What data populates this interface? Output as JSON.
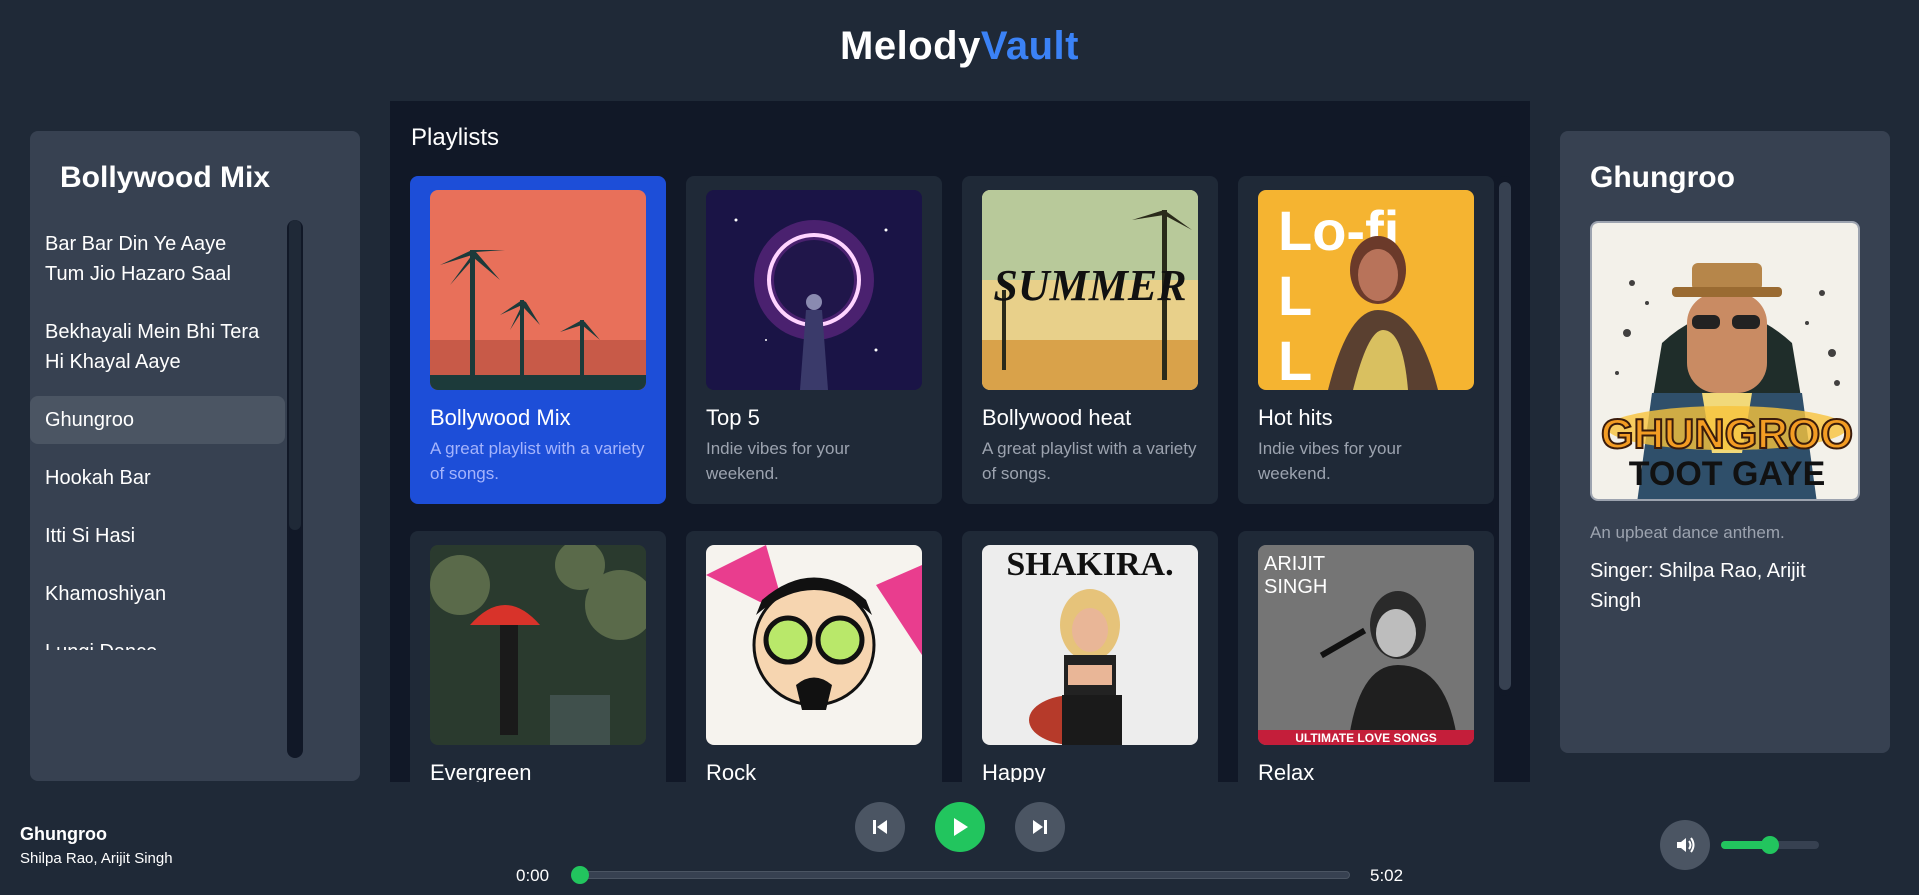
{
  "app": {
    "title_part1": "Melody",
    "title_part2": "Vault",
    "accent_color": "#3b82f6"
  },
  "sidebar": {
    "title": "Bollywood Mix",
    "songs": [
      {
        "line1": "Bar Bar Din Ye Aaye",
        "line2": "Tum Jio Hazaro Saal"
      },
      {
        "line1": "Bekhayali Mein Bhi Tera",
        "line2": "Hi Khayal Aaye"
      },
      {
        "line1": "Ghungroo",
        "line2": "",
        "active": true
      },
      {
        "line1": "Hookah Bar",
        "line2": ""
      },
      {
        "line1": "Itti Si Hasi",
        "line2": ""
      },
      {
        "line1": "Khamoshiyan",
        "line2": ""
      },
      {
        "line1": "Lungi Dance",
        "line2": ""
      }
    ]
  },
  "main": {
    "heading": "Playlists",
    "playlists": [
      {
        "title": "Bollywood Mix",
        "desc": "A great playlist with a variety of songs.",
        "art": "palm-sunset-art",
        "active": true
      },
      {
        "title": "Top 5",
        "desc": "Indie vibes for your weekend.",
        "art": "cosmic-planet-art"
      },
      {
        "title": "Bollywood heat",
        "desc": "A great playlist with a variety of songs.",
        "art": "summer-palms-art"
      },
      {
        "title": "Hot hits",
        "desc": "Indie vibes for your weekend.",
        "art": "lofi-portrait-art"
      },
      {
        "title": "Evergreen",
        "desc": "",
        "art": "red-umbrella-art"
      },
      {
        "title": "Rock",
        "desc": "",
        "art": "psy-cartoon-art"
      },
      {
        "title": "Happy",
        "desc": "",
        "art": "shakira-album-art"
      },
      {
        "title": "Relax",
        "desc": "",
        "art": "arijit-singh-art"
      }
    ]
  },
  "now_playing_panel": {
    "title": "Ghungroo",
    "description": "An upbeat dance anthem.",
    "singer": "Singer: Shilpa Rao, Arijit Singh",
    "cover_text_1": "GHUNGROO",
    "cover_text_2": "TOOT GAYE"
  },
  "player": {
    "track_title": "Ghungroo",
    "track_artist": "Shilpa Rao, Arijit Singh",
    "current_time": "0:00",
    "total_time": "5:02",
    "progress_fraction": 0.0,
    "volume_fraction": 0.5,
    "play_color": "#22c55e"
  }
}
